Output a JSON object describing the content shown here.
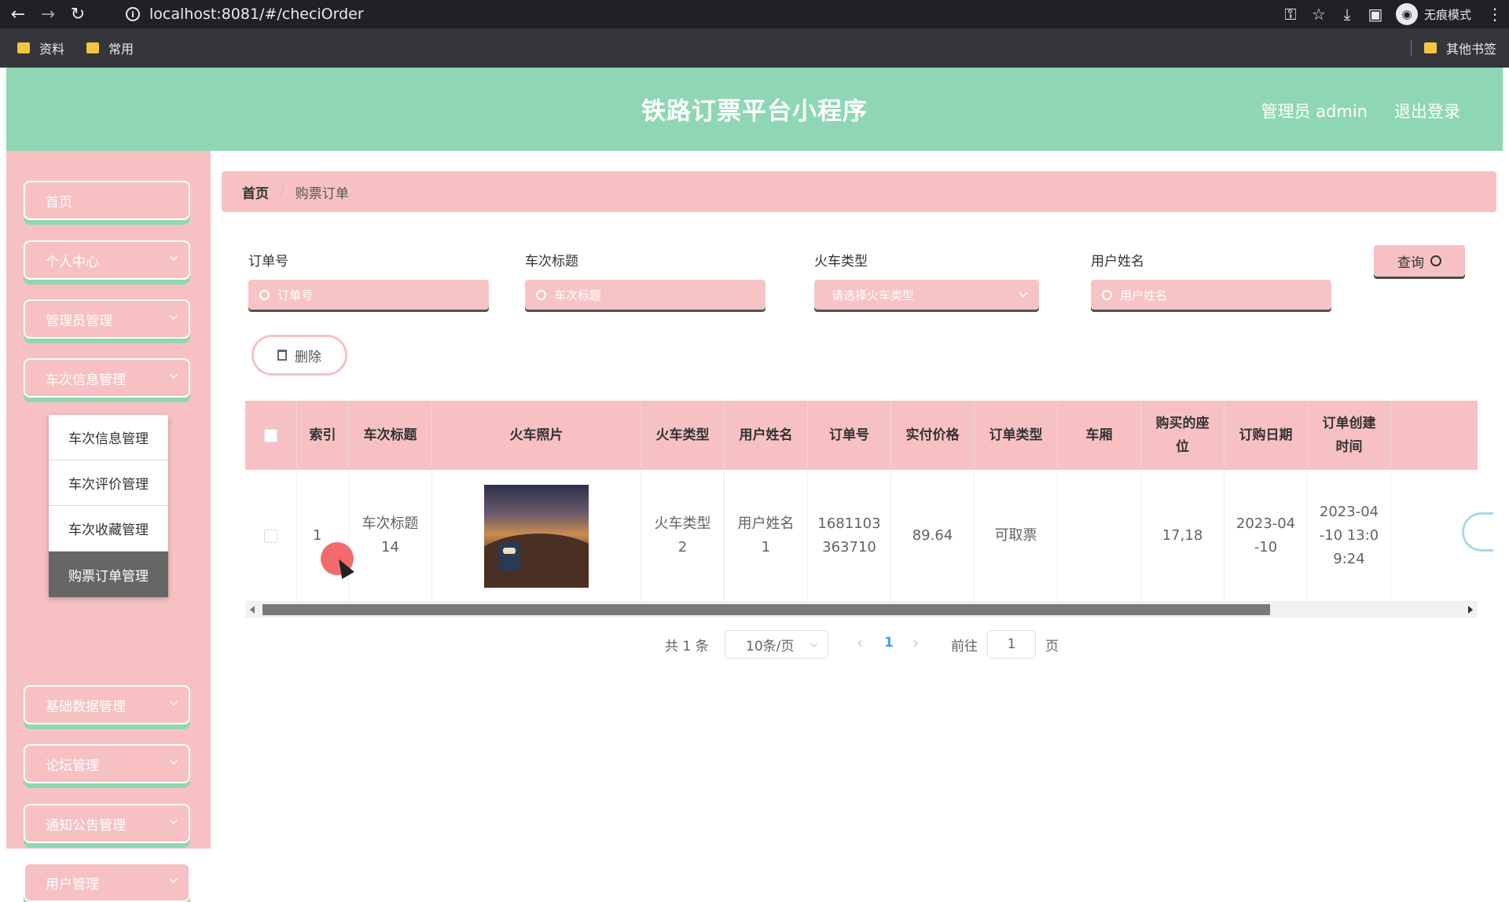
{
  "browser": {
    "url": "localhost:8081/#/checiOrder",
    "incognito_label": "无痕模式",
    "bookmarks": [
      "资料",
      "常用"
    ],
    "other_bookmarks": "其他书签"
  },
  "header": {
    "title": "铁路订票平台小程序",
    "user": "管理员 admin",
    "logout": "退出登录"
  },
  "sidebar": {
    "items": [
      "首页",
      "个人中心",
      "管理员管理",
      "车次信息管理",
      "基础数据管理",
      "论坛管理",
      "通知公告管理",
      "用户管理"
    ],
    "submenu": [
      "车次信息管理",
      "车次评价管理",
      "车次收藏管理",
      "购票订单管理"
    ]
  },
  "breadcrumb": {
    "home": "首页",
    "separator": "/",
    "current": "购票订单"
  },
  "filters": {
    "order_no": {
      "label": "订单号",
      "placeholder": "订单号"
    },
    "train_title": {
      "label": "车次标题",
      "placeholder": "车次标题"
    },
    "train_type": {
      "label": "火车类型",
      "placeholder": "请选择火车类型"
    },
    "user_name": {
      "label": "用户姓名",
      "placeholder": "用户姓名"
    },
    "query_label": "查询"
  },
  "actions": {
    "delete_label": "删除"
  },
  "table": {
    "headers": [
      "索引",
      "车次标题",
      "火车照片",
      "火车类型",
      "用户姓名",
      "订单号",
      "实付价格",
      "订单类型",
      "车厢",
      "购买的座位",
      "订购日期",
      "订单创建时间"
    ],
    "rows": [
      {
        "index": "1",
        "train_title": "车次标题14",
        "train_type": "火车类型2",
        "user_name": "用户姓名1",
        "order_no": "1681103363710",
        "price": "89.64",
        "order_type": "可取票",
        "carriage": "",
        "seats": "17,18",
        "order_date": "2023-04-10",
        "created_time": "2023-04-10 13:09:24"
      }
    ]
  },
  "pagination": {
    "total": "共 1 条",
    "page_size": "10条/页",
    "current_page": "1",
    "goto_label": "前往",
    "goto_value": "1",
    "page_unit": "页"
  },
  "colors": {
    "header_bg": "#8fd7b4",
    "sidebar_bg": "#f7c1c3",
    "accent": "#409eff"
  }
}
